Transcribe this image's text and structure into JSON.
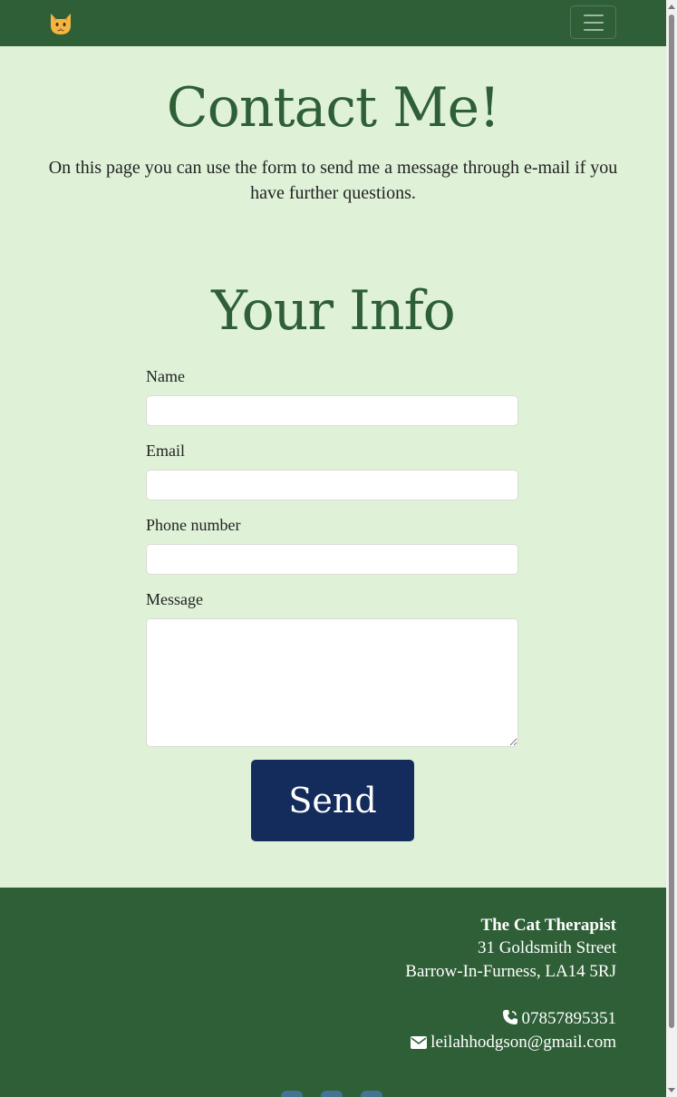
{
  "nav": {
    "logo_icon": "cat-face-icon",
    "menu_icon": "hamburger-icon"
  },
  "header": {
    "title": "Contact Me!",
    "intro": "On this page you can use the form to send me a message through e-mail if you have further questions."
  },
  "form": {
    "heading": "Your Info",
    "name_label": "Name",
    "name_value": "",
    "email_label": "Email",
    "email_value": "",
    "phone_label": "Phone number",
    "phone_value": "",
    "message_label": "Message",
    "message_value": "",
    "send_label": "Send"
  },
  "footer": {
    "business_name": "The Cat Therapist",
    "address_line1": "31 Goldsmith Street",
    "address_line2": "Barrow-In-Furness, LA14 5RJ",
    "phone_icon": "phone-icon",
    "phone": "07857895351",
    "email_icon": "envelope-icon",
    "email": "leilahhodgson@gmail.com"
  },
  "colors": {
    "nav_bg": "#2f5f37",
    "page_bg": "#dff2d8",
    "heading": "#2f5f37",
    "button_bg": "#142c5c"
  }
}
